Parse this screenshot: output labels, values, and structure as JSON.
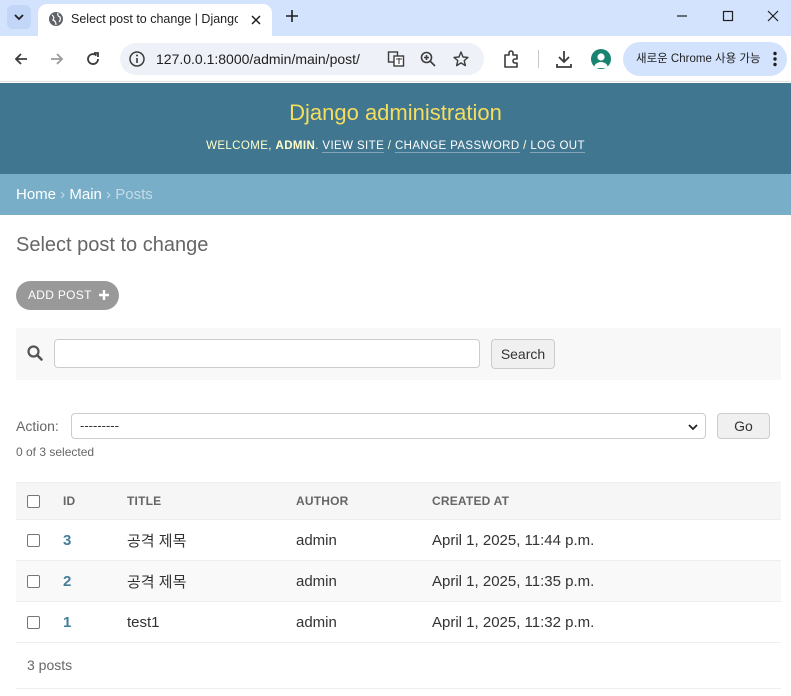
{
  "browser": {
    "tab_title": "Select post to change | Django site admin",
    "url": "127.0.0.1:8000/admin/main/post/",
    "chrome_promo": "새로운 Chrome 사용 가능",
    "icons": [
      "tab-search-icon",
      "globe-icon",
      "close-icon",
      "plus-icon",
      "minimize-icon",
      "maximize-icon",
      "back-icon",
      "forward-icon",
      "reload-icon",
      "site-info-icon",
      "translate-icon",
      "zoom-icon",
      "star-icon",
      "extensions-icon",
      "download-icon",
      "profile-icon",
      "kebab-icon"
    ]
  },
  "header": {
    "brand": "Django administration",
    "welcome": "Welcome, ",
    "user": "admin",
    "view_site": "View site",
    "change_password": "Change password",
    "log_out": "Log out",
    "brand_color": "#f5dd5d",
    "bg_color": "#417690"
  },
  "breadcrumbs": {
    "home": "Home",
    "app": "Main",
    "current": "Posts"
  },
  "main": {
    "title": "Select post to change",
    "add_button": "Add post",
    "search_placeholder": "",
    "search_button": "Search",
    "action_label": "Action:",
    "action_selected": "---------",
    "go_button": "Go",
    "selected_count": "0 of 3 selected",
    "columns": [
      "ID",
      "Title",
      "Author",
      "Created at"
    ],
    "rows": [
      {
        "id": "3",
        "title": "공격 제목",
        "author": "admin",
        "created": "April 1, 2025, 11:44 p.m."
      },
      {
        "id": "2",
        "title": "공격 제목",
        "author": "admin",
        "created": "April 1, 2025, 11:35 p.m."
      },
      {
        "id": "1",
        "title": "test1",
        "author": "admin",
        "created": "April 1, 2025, 11:32 p.m."
      }
    ],
    "paginator": "3 posts"
  }
}
